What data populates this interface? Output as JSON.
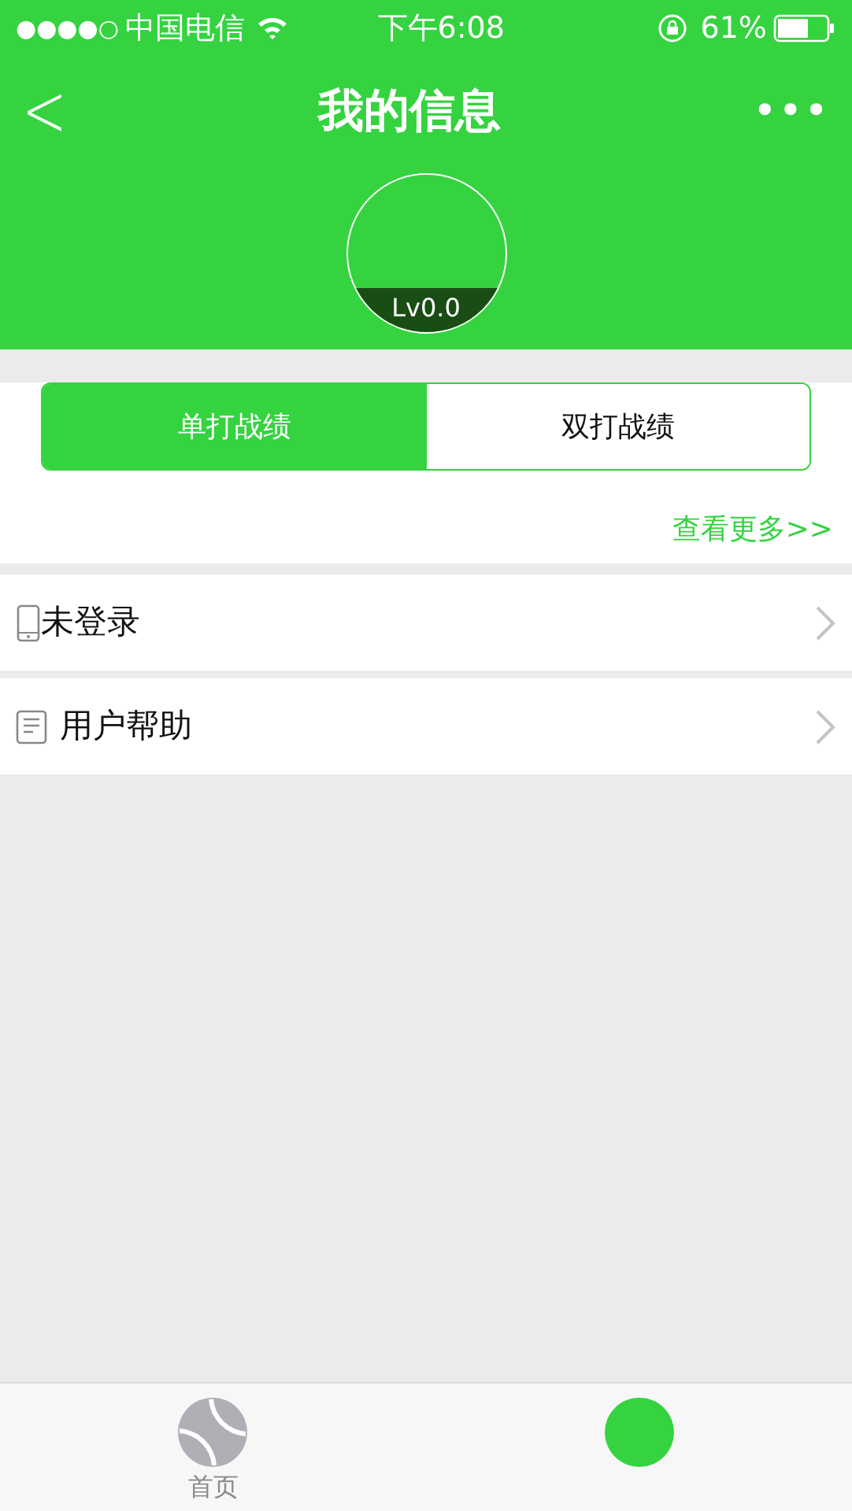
{
  "status_bar": {
    "signal": "●●●●○",
    "carrier": "中国电信",
    "time": "下午6:08",
    "battery": "61%"
  },
  "nav": {
    "back": "<",
    "title": "我的信息",
    "more": "•••"
  },
  "profile": {
    "level": "Lv0.0"
  },
  "record_tabs": [
    {
      "label": "单打战绩",
      "selected": true
    },
    {
      "label": "双打战绩",
      "selected": false
    }
  ],
  "more_link": "查看更多>>",
  "menu": [
    {
      "kind": "phone",
      "label": "未登录"
    },
    {
      "kind": "doc",
      "label": "用户帮助"
    }
  ],
  "tab_bar": [
    {
      "kind": "ball",
      "label": "首页",
      "selected": false
    },
    {
      "kind": "dot",
      "selected": true
    }
  ]
}
